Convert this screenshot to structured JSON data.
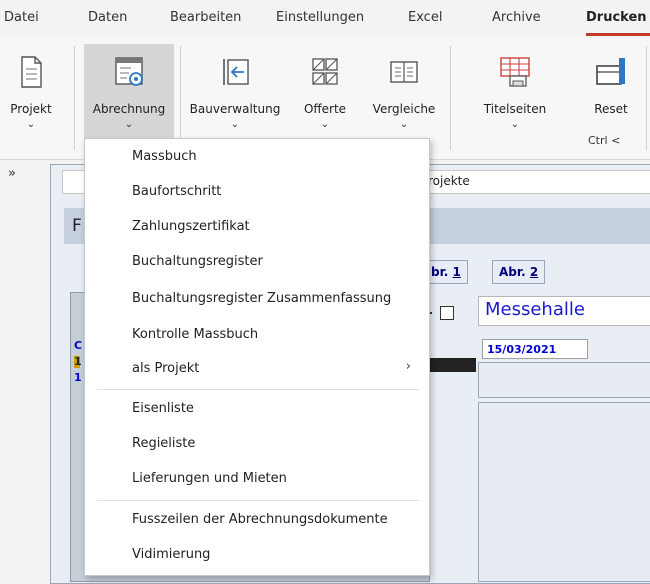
{
  "menubar": {
    "tabs": [
      "Datei",
      "Daten",
      "Bearbeiten",
      "Einstellungen",
      "Excel",
      "Archive",
      "Drucken"
    ],
    "active_tab": "Drucken",
    "accent_color": "#c0392b"
  },
  "ribbon": {
    "buttons": [
      {
        "label": "Projekt",
        "icon": "document-icon"
      },
      {
        "label": "Abrechnung",
        "icon": "invoice-gear-icon"
      },
      {
        "label": "Bauverwaltung",
        "icon": "arrow-left-box-icon"
      },
      {
        "label": "Offerte",
        "icon": "grid-slash-icon"
      },
      {
        "label": "Vergleiche",
        "icon": "compare-columns-icon"
      },
      {
        "label": "Titelseiten",
        "icon": "table-print-icon"
      },
      {
        "label": "Reset",
        "icon": "reset-panel-icon"
      }
    ],
    "chevron": "⌄",
    "ctrl_note": "Ctrl <"
  },
  "background": {
    "more_chevron": "»",
    "window_title_fragment": "rojekte",
    "header_letter": "F",
    "tabs": [
      {
        "prefix": "br. ",
        "number": "1"
      },
      {
        "prefix": "Abr. ",
        "number": "2"
      }
    ],
    "project_name": "Messehalle",
    "date": "15/03/2021",
    "left_stub": [
      "C",
      "1",
      "1"
    ]
  },
  "dropdown": {
    "items": [
      "Massbuch",
      "Baufortschritt",
      "Zahlungszertifikat",
      "Buchaltungsregister",
      "Buchaltungsregister Zusammenfassung",
      "Kontrolle Massbuch",
      "als Projekt",
      "Eisenliste",
      "Regieliste",
      "Lieferungen und Mieten",
      "Fusszeilen der Abrechnungsdokumente",
      "Vidimierung"
    ],
    "submenu_arrow": "›"
  }
}
